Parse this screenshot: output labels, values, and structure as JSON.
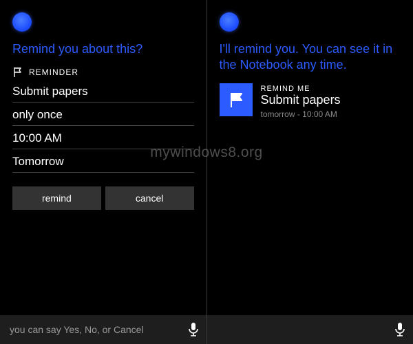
{
  "left": {
    "prompt": "Remind you about this?",
    "section_label": "REMINDER",
    "fields": {
      "subject": "Submit papers",
      "recurrence": "only once",
      "time": "10:00 AM",
      "day": "Tomorrow"
    },
    "buttons": {
      "remind": "remind",
      "cancel": "cancel"
    },
    "input_hint": "you can say Yes, No, or Cancel"
  },
  "right": {
    "prompt": "I'll remind you. You can see it in the Notebook any time.",
    "card": {
      "eyebrow": "REMIND ME",
      "title": "Submit papers",
      "subtitle": "tomorrow - 10:00 AM"
    }
  },
  "watermark": "mywindows8.org"
}
